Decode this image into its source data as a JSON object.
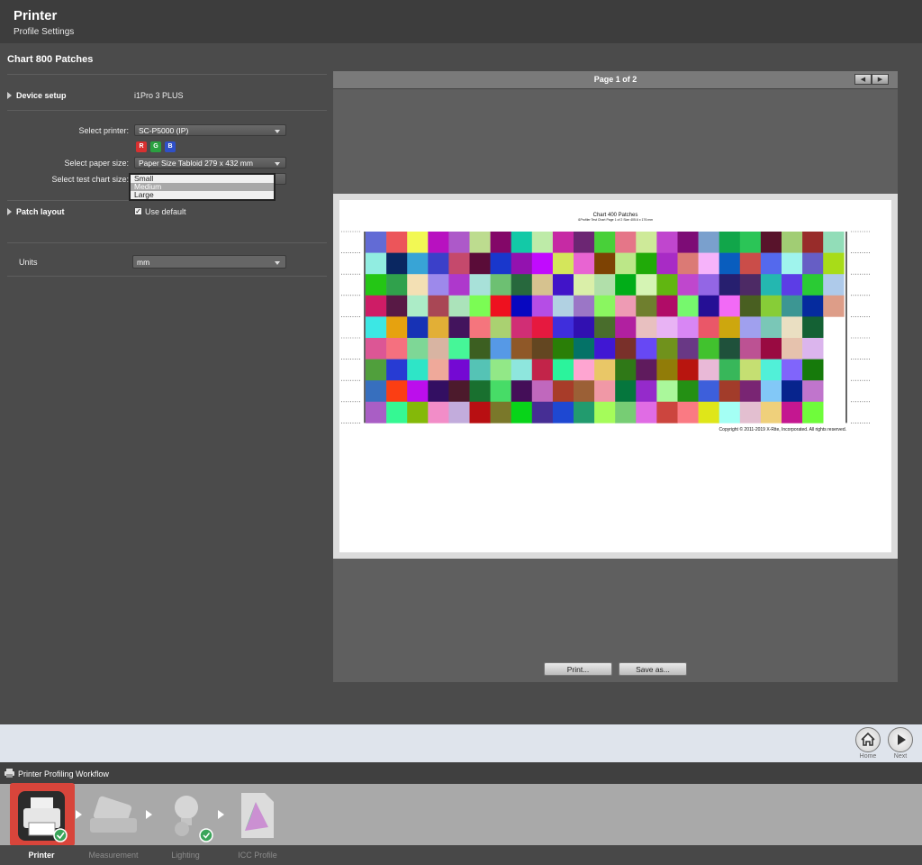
{
  "header": {
    "title": "Printer",
    "subtitle": "Profile Settings"
  },
  "left": {
    "section_title": "Chart 800 Patches",
    "device_setup": {
      "label": "Device setup",
      "value": "i1Pro 3 PLUS"
    },
    "select_printer": {
      "label": "Select printer:",
      "value": "SC-P5000 (IP)"
    },
    "channels": [
      "R",
      "G",
      "B"
    ],
    "select_paper": {
      "label": "Select paper size:",
      "value": "Paper Size Tabloid  279 x 432 mm"
    },
    "select_chart": {
      "label": "Select test chart size:",
      "options": [
        "Small",
        "Medium",
        "Large"
      ],
      "highlighted": "Medium"
    },
    "patch_layout": {
      "label": "Patch layout",
      "checkbox_label": "Use default",
      "checked": true
    },
    "units": {
      "label": "Units",
      "value": "mm"
    }
  },
  "preview": {
    "page_indicator": "Page 1 of 2",
    "chart_title": "Chart 400 Patches",
    "chart_subtitle": "i1Profiler Test Chart Page 1 of 2 Size 405.6 x 176 mm",
    "copyright": "Copyright © 2011-2019 X-Rite, Incorporated. All rights reserved.",
    "print_button": "Print...",
    "save_button": "Save as..."
  },
  "nav": {
    "home_label": "Home",
    "next_label": "Next"
  },
  "workflow": {
    "title": "Printer Profiling Workflow",
    "steps": [
      "Printer",
      "Measurement",
      "Lighting",
      "ICC Profile"
    ],
    "active_step": "Printer"
  },
  "colors": {
    "accent_active": "#d8453b",
    "panel": "#4b4b4b",
    "header": "#3d3d3d"
  }
}
